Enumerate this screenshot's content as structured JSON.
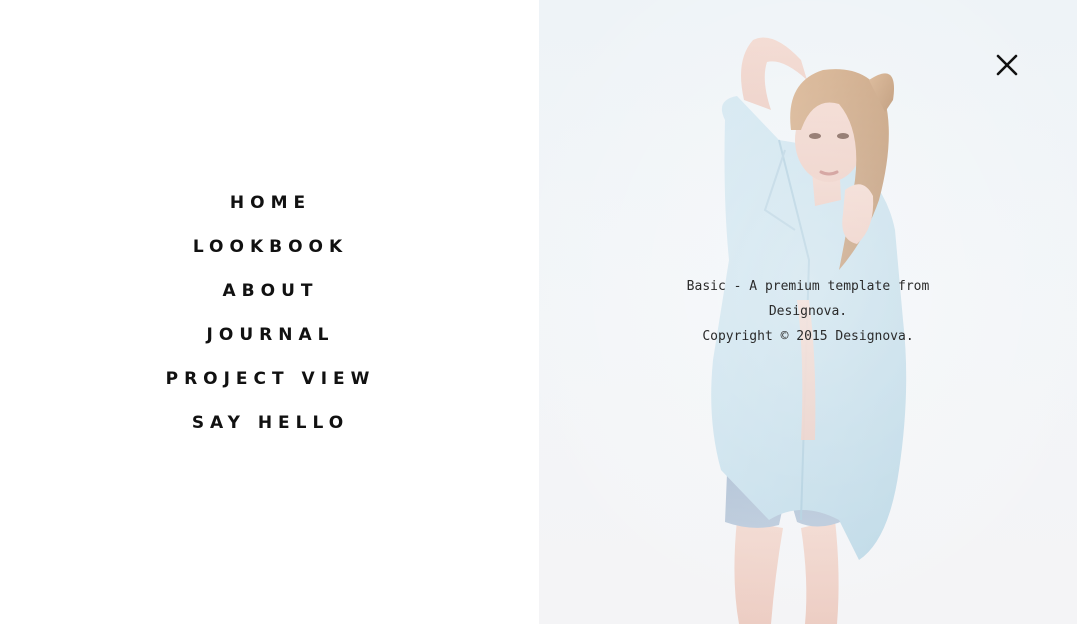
{
  "menu": {
    "items": [
      {
        "label": "HOME"
      },
      {
        "label": "LOOKBOOK"
      },
      {
        "label": "ABOUT"
      },
      {
        "label": "JOURNAL"
      },
      {
        "label": "PROJECT VIEW"
      },
      {
        "label": "SAY HELLO"
      }
    ]
  },
  "credits": {
    "line1": "Basic - A premium template from",
    "line2": "Designova.",
    "line3": "Copyright © 2015 Designova."
  },
  "close": {
    "icon": "close-icon"
  },
  "colors": {
    "menu_text": "#111111",
    "image_background": "#eef3f7",
    "credits_text": "#2b2b2b"
  }
}
